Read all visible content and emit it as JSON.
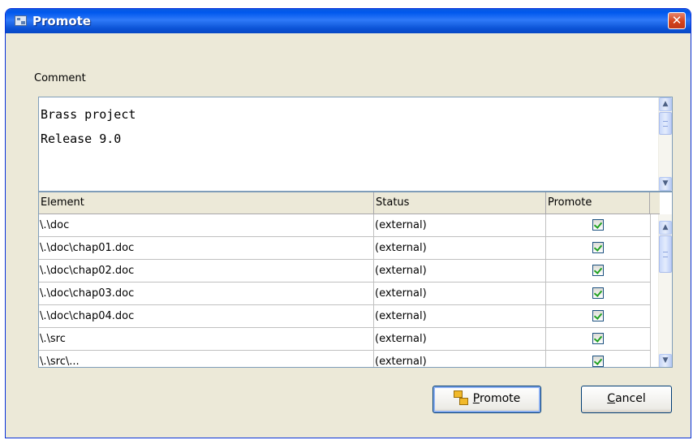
{
  "window": {
    "title": "Promote",
    "close_label": "✕"
  },
  "comment": {
    "label": "Comment",
    "text": "Brass project\nRelease 9.0"
  },
  "table": {
    "columns": [
      "Element",
      "Status",
      "Promote"
    ],
    "rows": [
      {
        "element": "\\.\\doc",
        "status": "(external)",
        "promote": true
      },
      {
        "element": "\\.\\doc\\chap01.doc",
        "status": "(external)",
        "promote": true
      },
      {
        "element": "\\.\\doc\\chap02.doc",
        "status": "(external)",
        "promote": true
      },
      {
        "element": "\\.\\doc\\chap03.doc",
        "status": "(external)",
        "promote": true
      },
      {
        "element": "\\.\\doc\\chap04.doc",
        "status": "(external)",
        "promote": true
      },
      {
        "element": "\\.\\src",
        "status": "(external)",
        "promote": true
      },
      {
        "element": "\\.\\src\\...",
        "status": "(external)",
        "promote": true
      }
    ]
  },
  "buttons": {
    "promote_first": "P",
    "promote_rest": "romote",
    "cancel_first": "C",
    "cancel_rest": "ancel"
  },
  "icons": {
    "window_icon": "promote-window-icon",
    "promote_button_icon": "promote-icon",
    "scroll_up": "chevron-up-icon",
    "scroll_down": "chevron-down-icon"
  },
  "colors": {
    "titlebar": "#0058ee",
    "dialog_bg": "#ece9d8",
    "close": "#d4421a",
    "check": "#21a121"
  }
}
